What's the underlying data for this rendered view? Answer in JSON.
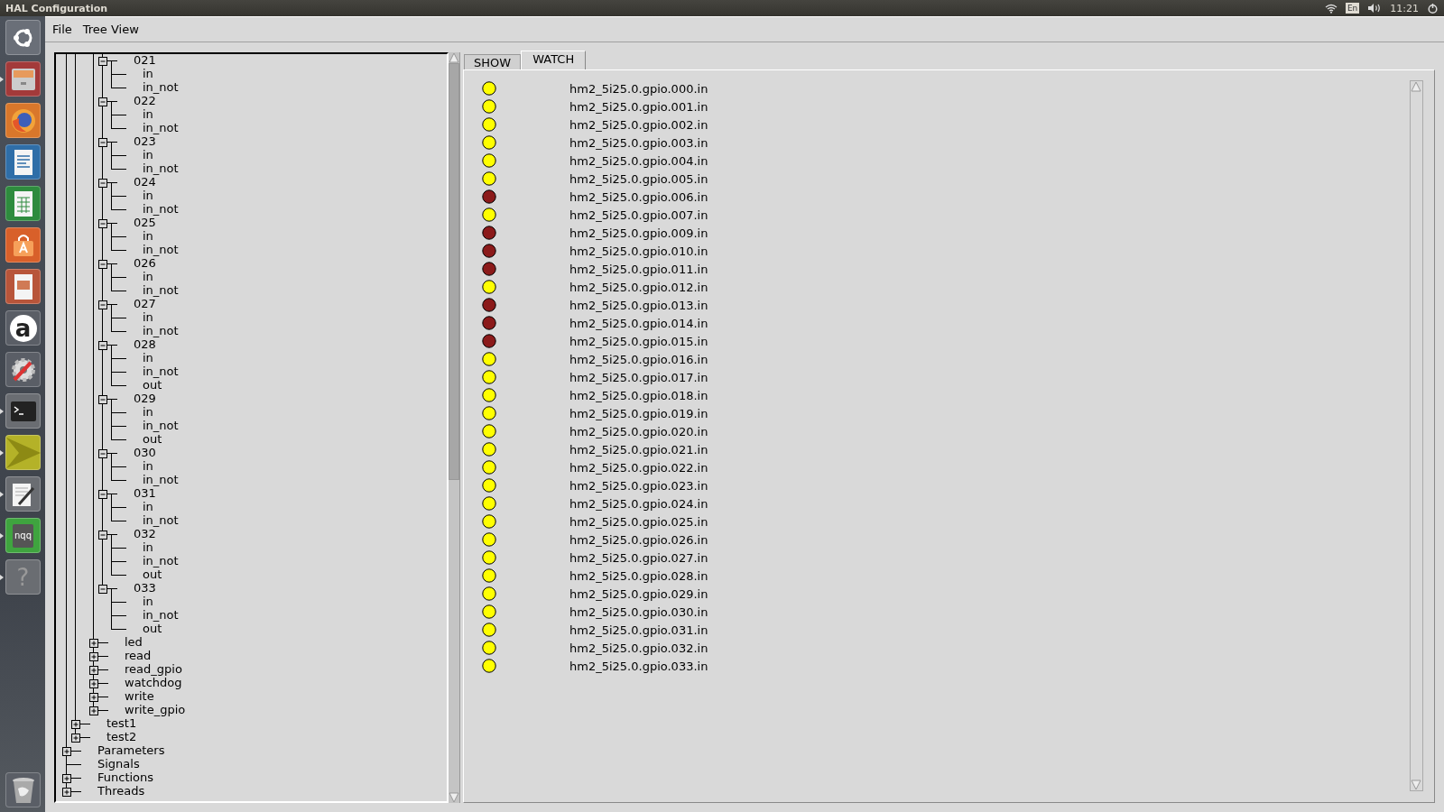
{
  "top_bar": {
    "title": "HAL Configuration",
    "keyboard_layout": "En",
    "clock": "11:21"
  },
  "launcher": [
    {
      "kind": "ubuntu",
      "running": false
    },
    {
      "kind": "files",
      "running": true
    },
    {
      "kind": "firefox",
      "running": false
    },
    {
      "kind": "writer",
      "running": false
    },
    {
      "kind": "calc",
      "running": false
    },
    {
      "kind": "store",
      "running": false
    },
    {
      "kind": "impress",
      "running": false
    },
    {
      "kind": "amazon",
      "glyph": "a",
      "running": false
    },
    {
      "kind": "settings",
      "running": false
    },
    {
      "kind": "terminal",
      "running": true
    },
    {
      "kind": "sublime",
      "running": true
    },
    {
      "kind": "editor",
      "running": true
    },
    {
      "kind": "notes",
      "glyph": "nqq",
      "running": true
    },
    {
      "kind": "help",
      "glyph": "?",
      "running": true
    },
    {
      "kind": "trash",
      "running": false
    }
  ],
  "menu": [
    "File",
    "Tree View"
  ],
  "tree": {
    "items": [
      {
        "children": [
          {
            "children": [
              {
                "children": [
                  {
                    "label": "021",
                    "expanded": true,
                    "children": [
                      {
                        "label": "in"
                      },
                      {
                        "label": "in_not"
                      }
                    ]
                  },
                  {
                    "label": "022",
                    "expanded": true,
                    "children": [
                      {
                        "label": "in"
                      },
                      {
                        "label": "in_not"
                      }
                    ]
                  },
                  {
                    "label": "023",
                    "expanded": true,
                    "children": [
                      {
                        "label": "in"
                      },
                      {
                        "label": "in_not"
                      }
                    ]
                  },
                  {
                    "label": "024",
                    "expanded": true,
                    "children": [
                      {
                        "label": "in"
                      },
                      {
                        "label": "in_not"
                      }
                    ]
                  },
                  {
                    "label": "025",
                    "expanded": true,
                    "children": [
                      {
                        "label": "in"
                      },
                      {
                        "label": "in_not"
                      }
                    ]
                  },
                  {
                    "label": "026",
                    "expanded": true,
                    "children": [
                      {
                        "label": "in"
                      },
                      {
                        "label": "in_not"
                      }
                    ]
                  },
                  {
                    "label": "027",
                    "expanded": true,
                    "children": [
                      {
                        "label": "in"
                      },
                      {
                        "label": "in_not"
                      }
                    ]
                  },
                  {
                    "label": "028",
                    "expanded": true,
                    "children": [
                      {
                        "label": "in"
                      },
                      {
                        "label": "in_not"
                      },
                      {
                        "label": "out"
                      }
                    ]
                  },
                  {
                    "label": "029",
                    "expanded": true,
                    "children": [
                      {
                        "label": "in"
                      },
                      {
                        "label": "in_not"
                      },
                      {
                        "label": "out"
                      }
                    ]
                  },
                  {
                    "label": "030",
                    "expanded": true,
                    "children": [
                      {
                        "label": "in"
                      },
                      {
                        "label": "in_not"
                      }
                    ]
                  },
                  {
                    "label": "031",
                    "expanded": true,
                    "children": [
                      {
                        "label": "in"
                      },
                      {
                        "label": "in_not"
                      }
                    ]
                  },
                  {
                    "label": "032",
                    "expanded": true,
                    "children": [
                      {
                        "label": "in"
                      },
                      {
                        "label": "in_not"
                      },
                      {
                        "label": "out"
                      }
                    ]
                  },
                  {
                    "label": "033",
                    "expanded": true,
                    "children": [
                      {
                        "label": "in"
                      },
                      {
                        "label": "in_not"
                      },
                      {
                        "label": "out"
                      }
                    ]
                  }
                ]
              },
              {
                "label": "led",
                "expanded": false
              },
              {
                "label": "read",
                "expanded": false
              },
              {
                "label": "read_gpio",
                "expanded": false
              },
              {
                "label": "watchdog",
                "expanded": false
              },
              {
                "label": "write",
                "expanded": false
              },
              {
                "label": "write_gpio",
                "expanded": false
              }
            ]
          },
          {
            "label": "test1",
            "expanded": false
          },
          {
            "label": "test2",
            "expanded": false
          }
        ]
      },
      {
        "label": "Parameters",
        "expanded": false
      },
      {
        "label": "Signals"
      },
      {
        "label": "Functions",
        "expanded": false
      },
      {
        "label": "Threads",
        "expanded": false
      }
    ]
  },
  "tabs": [
    {
      "label": "SHOW",
      "selected": false
    },
    {
      "label": "WATCH",
      "selected": true
    }
  ],
  "watch": {
    "items": [
      {
        "name": "hm2_5i25.0.gpio.000.in",
        "on": true
      },
      {
        "name": "hm2_5i25.0.gpio.001.in",
        "on": true
      },
      {
        "name": "hm2_5i25.0.gpio.002.in",
        "on": true
      },
      {
        "name": "hm2_5i25.0.gpio.003.in",
        "on": true
      },
      {
        "name": "hm2_5i25.0.gpio.004.in",
        "on": true
      },
      {
        "name": "hm2_5i25.0.gpio.005.in",
        "on": true
      },
      {
        "name": "hm2_5i25.0.gpio.006.in",
        "on": false
      },
      {
        "name": "hm2_5i25.0.gpio.007.in",
        "on": true
      },
      {
        "name": "hm2_5i25.0.gpio.009.in",
        "on": false
      },
      {
        "name": "hm2_5i25.0.gpio.010.in",
        "on": false
      },
      {
        "name": "hm2_5i25.0.gpio.011.in",
        "on": false
      },
      {
        "name": "hm2_5i25.0.gpio.012.in",
        "on": true
      },
      {
        "name": "hm2_5i25.0.gpio.013.in",
        "on": false
      },
      {
        "name": "hm2_5i25.0.gpio.014.in",
        "on": false
      },
      {
        "name": "hm2_5i25.0.gpio.015.in",
        "on": false
      },
      {
        "name": "hm2_5i25.0.gpio.016.in",
        "on": true
      },
      {
        "name": "hm2_5i25.0.gpio.017.in",
        "on": true
      },
      {
        "name": "hm2_5i25.0.gpio.018.in",
        "on": true
      },
      {
        "name": "hm2_5i25.0.gpio.019.in",
        "on": true
      },
      {
        "name": "hm2_5i25.0.gpio.020.in",
        "on": true
      },
      {
        "name": "hm2_5i25.0.gpio.021.in",
        "on": true
      },
      {
        "name": "hm2_5i25.0.gpio.022.in",
        "on": true
      },
      {
        "name": "hm2_5i25.0.gpio.023.in",
        "on": true
      },
      {
        "name": "hm2_5i25.0.gpio.024.in",
        "on": true
      },
      {
        "name": "hm2_5i25.0.gpio.025.in",
        "on": true
      },
      {
        "name": "hm2_5i25.0.gpio.026.in",
        "on": true
      },
      {
        "name": "hm2_5i25.0.gpio.027.in",
        "on": true
      },
      {
        "name": "hm2_5i25.0.gpio.028.in",
        "on": true
      },
      {
        "name": "hm2_5i25.0.gpio.029.in",
        "on": true
      },
      {
        "name": "hm2_5i25.0.gpio.030.in",
        "on": true
      },
      {
        "name": "hm2_5i25.0.gpio.031.in",
        "on": true
      },
      {
        "name": "hm2_5i25.0.gpio.032.in",
        "on": true
      },
      {
        "name": "hm2_5i25.0.gpio.033.in",
        "on": true
      }
    ]
  }
}
